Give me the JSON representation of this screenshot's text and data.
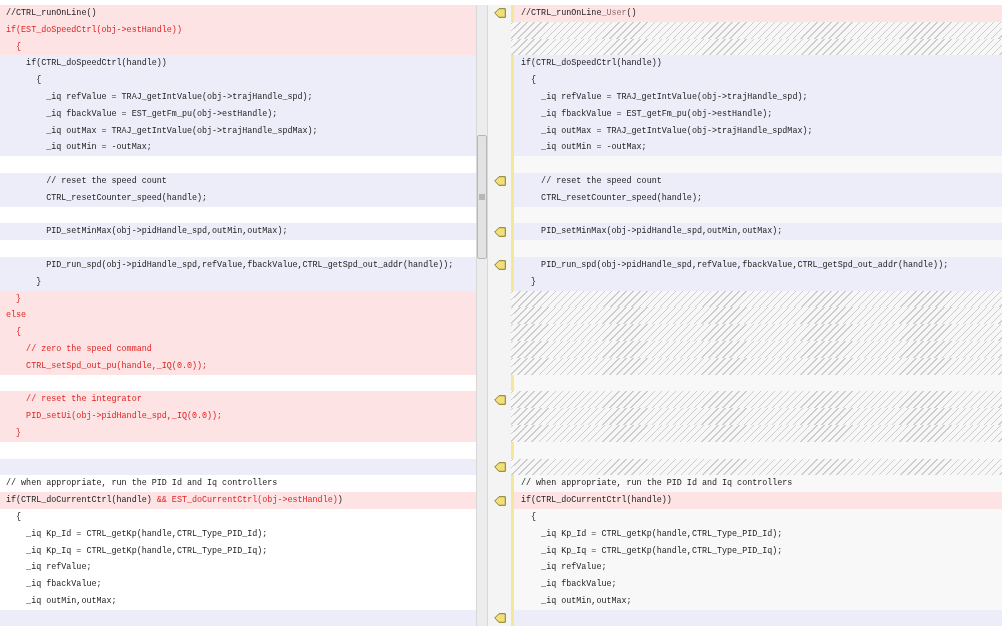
{
  "rows": [
    {
      "arrow": true,
      "left": {
        "kind": "removed",
        "text": "//CTRL_runOnLine()",
        "deleted": false
      },
      "right": {
        "kind": "removed",
        "parts": [
          {
            "text": "//CTRL_runOnLine",
            "changed": false
          },
          {
            "text": "_User",
            "changed": true
          },
          {
            "text": "()",
            "changed": false
          }
        ]
      }
    },
    {
      "arrow": false,
      "left": {
        "kind": "removed",
        "text": "if(EST_doSpeedCtrl(obj->estHandle))",
        "deleted": true
      },
      "right": {
        "kind": "filler"
      }
    },
    {
      "arrow": false,
      "left": {
        "kind": "removed",
        "text": "  {",
        "deleted": true
      },
      "right": {
        "kind": "filler"
      }
    },
    {
      "arrow": false,
      "left": {
        "kind": "modified",
        "text": "    if(CTRL_doSpeedCtrl(handle))",
        "deleted": false
      },
      "right": {
        "kind": "modified",
        "text": "if(CTRL_doSpeedCtrl(handle))",
        "deleted": false
      }
    },
    {
      "arrow": false,
      "left": {
        "kind": "modified",
        "text": "      {",
        "deleted": false
      },
      "right": {
        "kind": "modified",
        "text": "  {",
        "deleted": false
      }
    },
    {
      "arrow": false,
      "left": {
        "kind": "modified",
        "text": "        _iq refValue = TRAJ_getIntValue(obj->trajHandle_spd);",
        "deleted": false
      },
      "right": {
        "kind": "modified",
        "text": "    _iq refValue = TRAJ_getIntValue(obj->trajHandle_spd);",
        "deleted": false
      }
    },
    {
      "arrow": false,
      "left": {
        "kind": "modified",
        "text": "        _iq fbackValue = EST_getFm_pu(obj->estHandle);",
        "deleted": false
      },
      "right": {
        "kind": "modified",
        "text": "    _iq fbackValue = EST_getFm_pu(obj->estHandle);",
        "deleted": false
      }
    },
    {
      "arrow": false,
      "left": {
        "kind": "modified",
        "text": "        _iq outMax = TRAJ_getIntValue(obj->trajHandle_spdMax);",
        "deleted": false
      },
      "right": {
        "kind": "modified",
        "text": "    _iq outMax = TRAJ_getIntValue(obj->trajHandle_spdMax);",
        "deleted": false
      }
    },
    {
      "arrow": false,
      "left": {
        "kind": "modified",
        "text": "        _iq outMin = -outMax;",
        "deleted": false
      },
      "right": {
        "kind": "modified",
        "text": "    _iq outMin = -outMax;",
        "deleted": false
      }
    },
    {
      "arrow": false,
      "left": {
        "kind": "unchanged"
      },
      "right": {
        "kind": "unchanged"
      }
    },
    {
      "arrow": true,
      "left": {
        "kind": "modified",
        "text": "        // reset the speed count",
        "deleted": false
      },
      "right": {
        "kind": "modified",
        "text": "    // reset the speed count",
        "deleted": false
      }
    },
    {
      "arrow": false,
      "left": {
        "kind": "modified",
        "text": "        CTRL_resetCounter_speed(handle);",
        "deleted": false
      },
      "right": {
        "kind": "modified",
        "text": "    CTRL_resetCounter_speed(handle);",
        "deleted": false
      }
    },
    {
      "arrow": false,
      "left": {
        "kind": "unchanged"
      },
      "right": {
        "kind": "unchanged"
      }
    },
    {
      "arrow": true,
      "left": {
        "kind": "modified",
        "text": "        PID_setMinMax(obj->pidHandle_spd,outMin,outMax);",
        "deleted": false
      },
      "right": {
        "kind": "modified",
        "text": "    PID_setMinMax(obj->pidHandle_spd,outMin,outMax);",
        "deleted": false
      }
    },
    {
      "arrow": false,
      "left": {
        "kind": "unchanged"
      },
      "right": {
        "kind": "unchanged"
      }
    },
    {
      "arrow": true,
      "left": {
        "kind": "modified",
        "text": "        PID_run_spd(obj->pidHandle_spd,refValue,fbackValue,CTRL_getSpd_out_addr(handle));",
        "deleted": false
      },
      "right": {
        "kind": "modified",
        "text": "    PID_run_spd(obj->pidHandle_spd,refValue,fbackValue,CTRL_getSpd_out_addr(handle));",
        "deleted": false
      }
    },
    {
      "arrow": false,
      "left": {
        "kind": "modified",
        "text": "      }",
        "deleted": false
      },
      "right": {
        "kind": "modified",
        "text": "  }",
        "deleted": false
      }
    },
    {
      "arrow": false,
      "left": {
        "kind": "removed",
        "text": "  }",
        "deleted": true
      },
      "right": {
        "kind": "filler"
      }
    },
    {
      "arrow": false,
      "left": {
        "kind": "removed",
        "text": "else",
        "deleted": true
      },
      "right": {
        "kind": "filler"
      }
    },
    {
      "arrow": false,
      "left": {
        "kind": "removed",
        "text": "  {",
        "deleted": true
      },
      "right": {
        "kind": "filler"
      }
    },
    {
      "arrow": false,
      "left": {
        "kind": "removed",
        "text": "    // zero the speed command",
        "deleted": true
      },
      "right": {
        "kind": "filler"
      }
    },
    {
      "arrow": false,
      "left": {
        "kind": "removed",
        "text": "    CTRL_setSpd_out_pu(handle,_IQ(0.0));",
        "deleted": true
      },
      "right": {
        "kind": "filler"
      }
    },
    {
      "arrow": false,
      "left": {
        "kind": "unchanged"
      },
      "right": {
        "kind": "unchanged"
      }
    },
    {
      "arrow": true,
      "left": {
        "kind": "removed",
        "text": "    // reset the integrator",
        "deleted": true
      },
      "right": {
        "kind": "filler"
      }
    },
    {
      "arrow": false,
      "left": {
        "kind": "removed",
        "text": "    PID_setUi(obj->pidHandle_spd,_IQ(0.0));",
        "deleted": true
      },
      "right": {
        "kind": "filler"
      }
    },
    {
      "arrow": false,
      "left": {
        "kind": "removed",
        "text": "  }",
        "deleted": true
      },
      "right": {
        "kind": "filler"
      }
    },
    {
      "arrow": false,
      "left": {
        "kind": "unchanged"
      },
      "right": {
        "kind": "unchanged"
      }
    },
    {
      "arrow": true,
      "left": {
        "kind": "modified"
      },
      "right": {
        "kind": "filler"
      }
    },
    {
      "arrow": false,
      "left": {
        "kind": "unchanged",
        "text": "// when appropriate, run the PID Id and Iq controllers",
        "deleted": false
      },
      "right": {
        "kind": "unchanged",
        "text": "// when appropriate, run the PID Id and Iq controllers",
        "deleted": false
      }
    },
    {
      "arrow": true,
      "left": {
        "kind": "removed",
        "parts": [
          {
            "text": "if(CTRL_doCurrentCtrl(handle) ",
            "deleted": false
          },
          {
            "text": "&& EST_doCurrentCtrl(obj->estHandle)",
            "deleted": true
          },
          {
            "text": ")",
            "deleted": false
          }
        ]
      },
      "right": {
        "kind": "removed",
        "text": "if(CTRL_doCurrentCtrl(handle))",
        "deleted": false
      }
    },
    {
      "arrow": false,
      "left": {
        "kind": "unchanged",
        "text": "  {",
        "deleted": false
      },
      "right": {
        "kind": "unchanged",
        "text": "  {",
        "deleted": false
      }
    },
    {
      "arrow": false,
      "left": {
        "kind": "unchanged",
        "text": "    _iq Kp_Id = CTRL_getKp(handle,CTRL_Type_PID_Id);",
        "deleted": false
      },
      "right": {
        "kind": "unchanged",
        "text": "    _iq Kp_Id = CTRL_getKp(handle,CTRL_Type_PID_Id);",
        "deleted": false
      }
    },
    {
      "arrow": false,
      "left": {
        "kind": "unchanged",
        "text": "    _iq Kp_Iq = CTRL_getKp(handle,CTRL_Type_PID_Iq);",
        "deleted": false
      },
      "right": {
        "kind": "unchanged",
        "text": "    _iq Kp_Iq = CTRL_getKp(handle,CTRL_Type_PID_Iq);",
        "deleted": false
      }
    },
    {
      "arrow": false,
      "left": {
        "kind": "unchanged",
        "text": "    _iq refValue;",
        "deleted": false
      },
      "right": {
        "kind": "unchanged",
        "text": "    _iq refValue;",
        "deleted": false
      }
    },
    {
      "arrow": false,
      "left": {
        "kind": "unchanged",
        "text": "    _iq fbackValue;",
        "deleted": false
      },
      "right": {
        "kind": "unchanged",
        "text": "    _iq fbackValue;",
        "deleted": false
      }
    },
    {
      "arrow": false,
      "left": {
        "kind": "unchanged",
        "text": "    _iq outMin,outMax;",
        "deleted": false
      },
      "right": {
        "kind": "unchanged",
        "text": "    _iq outMin,outMax;",
        "deleted": false
      }
    },
    {
      "arrow": true,
      "left": {
        "kind": "modified"
      },
      "right": {
        "kind": "modified"
      }
    }
  ]
}
